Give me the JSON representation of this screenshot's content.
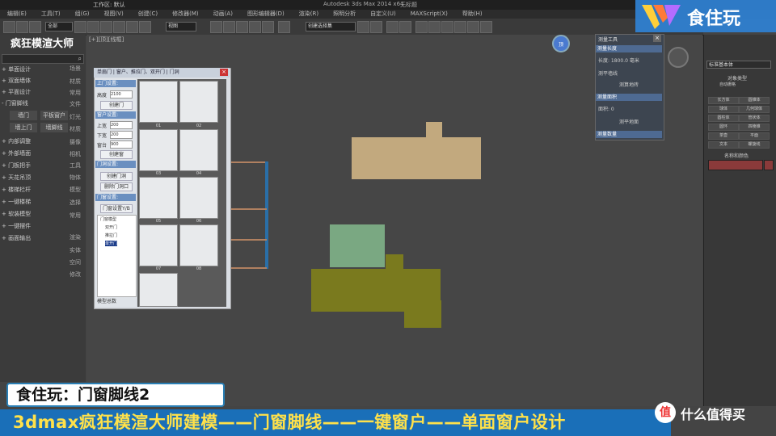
{
  "window": {
    "title": "Autodesk 3ds Max 2014 x64",
    "workspace": "工作区: 默认",
    "status": "无标题"
  },
  "menu": [
    "编辑(E)",
    "工具(T)",
    "组(G)",
    "视图(V)",
    "创建(C)",
    "修改器(M)",
    "动画(A)",
    "图形编辑器(D)",
    "渲染(R)",
    "照明分析",
    "自定义(U)",
    "MAXScript(X)",
    "帮助(H)"
  ],
  "toolbar": {
    "selection_filter": "全部",
    "view_dropdown": "视图",
    "named_selection": "创建选择集"
  },
  "plugin": {
    "title": "疯狂模渲大师",
    "items": [
      "单面设计",
      "双面墙体",
      "平面设计",
      "门窗脚线",
      "内部调整",
      "外部墙面",
      "门板把手",
      "天花吊顶",
      "楼梯栏杆",
      "一键楼梯",
      "软装模型",
      "一键摆件",
      "画面输出"
    ],
    "sub_items": [
      "墙门",
      "平板窗户",
      "墙上门",
      "墙脚线"
    ],
    "side_items": [
      "场景",
      "材质",
      "常用",
      "文件",
      "灯光",
      "材质",
      "摄像",
      "相机",
      "工具",
      "物体",
      "模型",
      "选择",
      "常用",
      "渲染",
      "实体",
      "空间",
      "修改"
    ]
  },
  "viewport": {
    "label": "[+][顶][线框]"
  },
  "door_dialog": {
    "title": "单扇门 | 窗户、推拉门、双开门 | 门洞",
    "sections": [
      "上门设置:",
      "窗户设置:",
      "门洞设置:",
      "门窗设置:"
    ],
    "fields": {
      "height_label": "高度",
      "height_value": "2100",
      "upper_label": "上宽",
      "upper_value": "200",
      "lower_label": "下宽",
      "lower_value": "200",
      "bottom_label": "窗台",
      "bottom_value": "900"
    },
    "buttons": [
      "创建门",
      "创建窗",
      "创建门洞",
      "删除门洞口",
      "门窗设置Y/B"
    ],
    "tree": [
      "门窗模型",
      "双开门",
      "推拉门",
      "单开门"
    ],
    "thumb_labels": [
      "01",
      "02",
      "03",
      "04",
      "05",
      "06",
      "07",
      "08"
    ],
    "footer": "模型总数"
  },
  "measure_dialog": {
    "title": "测量工具",
    "sections": [
      "测量长度",
      "测量面积",
      "测量数量"
    ],
    "rows": [
      "长度: 1800.0 毫米",
      "测平墙线",
      "测算地砖",
      "面积: 0",
      "测平地面"
    ]
  },
  "command_panel": {
    "dropdown": "标准基本体",
    "section": "对象类型",
    "auto_grid": "自动栅格",
    "buttons": [
      "长方体",
      "圆锥体",
      "球体",
      "几何球体",
      "圆柱体",
      "管状体",
      "圆环",
      "四棱锥",
      "茶壶",
      "平面",
      "文本",
      "螺旋线"
    ],
    "name_section": "名称和颜色"
  },
  "overlay": {
    "brand": "食住玩",
    "caption_small": "食住玩：门窗脚线2",
    "caption_large": "3dmax疯狂模渲大师建模——门窗脚线——一键窗户——单面窗户设计",
    "watermark": "什么值得买",
    "watermark_logo": "值",
    "nav_cube": "顶"
  },
  "colors": {
    "room_tan": "#c2a97e",
    "room_green": "#7aa882",
    "room_olive": "#7a7a1e",
    "accent_blue": "#1a6fb8"
  }
}
